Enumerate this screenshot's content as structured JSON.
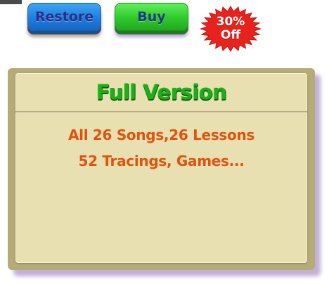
{
  "toolbar": {
    "restore_label": "Restore",
    "buy_label": "Buy"
  },
  "badge": {
    "line1": "30%",
    "line2": "Off",
    "color": "#e8231d"
  },
  "panel": {
    "title": "Full Version",
    "features": [
      "All 26 Songs,26 Lessons",
      "52 Tracings, Games..."
    ]
  },
  "colors": {
    "restore_button": "#1f7ee0",
    "buy_button": "#2fc92c",
    "title_green": "#1fae19",
    "feature_orange": "#e0520f",
    "panel_bg": "#e8e0b0",
    "panel_frame": "#b5ab76"
  }
}
